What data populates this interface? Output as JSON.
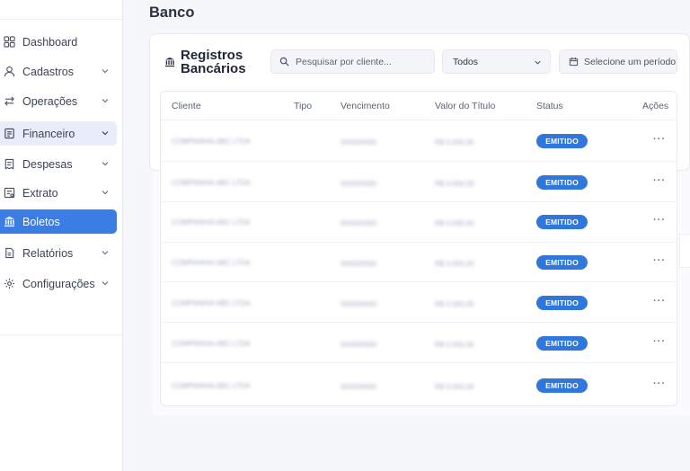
{
  "page": {
    "title": "Banco"
  },
  "sidebar": {
    "items": [
      {
        "label": "Dashboard",
        "icon": "grid-icon",
        "has_chevron": false
      },
      {
        "label": "Cadastros",
        "icon": "user-icon",
        "has_chevron": true
      },
      {
        "label": "Operações",
        "icon": "arrows-icon",
        "has_chevron": true
      },
      {
        "label": "Financeiro",
        "icon": "ledger-icon",
        "has_chevron": true
      },
      {
        "label": "Despesas",
        "icon": "receipt-icon",
        "has_chevron": true
      },
      {
        "label": "Extrato",
        "icon": "statement-icon",
        "has_chevron": true
      },
      {
        "label": "Boletos",
        "icon": "bank-icon",
        "has_chevron": false
      },
      {
        "label": "Relatórios",
        "icon": "report-icon",
        "has_chevron": true
      },
      {
        "label": "Configurações",
        "icon": "gear-icon",
        "has_chevron": true
      }
    ]
  },
  "card": {
    "title_line1": "Registros",
    "title_line2": "Bancários",
    "search_placeholder": "Pesquisar por cliente...",
    "filter_value": "Todos",
    "period_placeholder": "Selecione um período"
  },
  "table": {
    "headers": {
      "client": "Cliente",
      "type": "Tipo",
      "due": "Vencimento",
      "value": "Valor do Título",
      "status": "Status",
      "actions": "Ações"
    },
    "rows": [
      {
        "client": "COMPANHIA ABC LTDA",
        "type": "",
        "due": "00/00/0000",
        "value": "R$ 0.000,00",
        "status": "EMITIDO",
        "actions": "···"
      },
      {
        "client": "COMPANHIA ABC LTDA",
        "type": "",
        "due": "00/00/0000",
        "value": "R$ 0.000,00",
        "status": "EMITIDO",
        "actions": "···"
      },
      {
        "client": "COMPANHIA ABC LTDA",
        "type": "",
        "due": "00/00/0000",
        "value": "R$ 0.000,00",
        "status": "EMITIDO",
        "actions": "···"
      },
      {
        "client": "COMPANHIA ABC LTDA",
        "type": "",
        "due": "00/00/0000",
        "value": "R$ 0.000,00",
        "status": "EMITIDO",
        "actions": "···"
      },
      {
        "client": "COMPANHIA ABC LTDA",
        "type": "",
        "due": "00/00/0000",
        "value": "R$ 0.000,00",
        "status": "EMITIDO",
        "actions": "···"
      },
      {
        "client": "COMPANHIA ABC LTDA",
        "type": "",
        "due": "00/00/0000",
        "value": "R$ 0.000,00",
        "status": "EMITIDO",
        "actions": "···"
      },
      {
        "client": "COMPANHIA ABC LTDA",
        "type": "",
        "due": "00/00/0000",
        "value": "R$ 0.000,00",
        "status": "EMITIDO",
        "actions": "···"
      }
    ]
  },
  "colors": {
    "accent": "#3a7de4",
    "badge": "#2f77dd",
    "selected_bg": "#e9edf9"
  }
}
